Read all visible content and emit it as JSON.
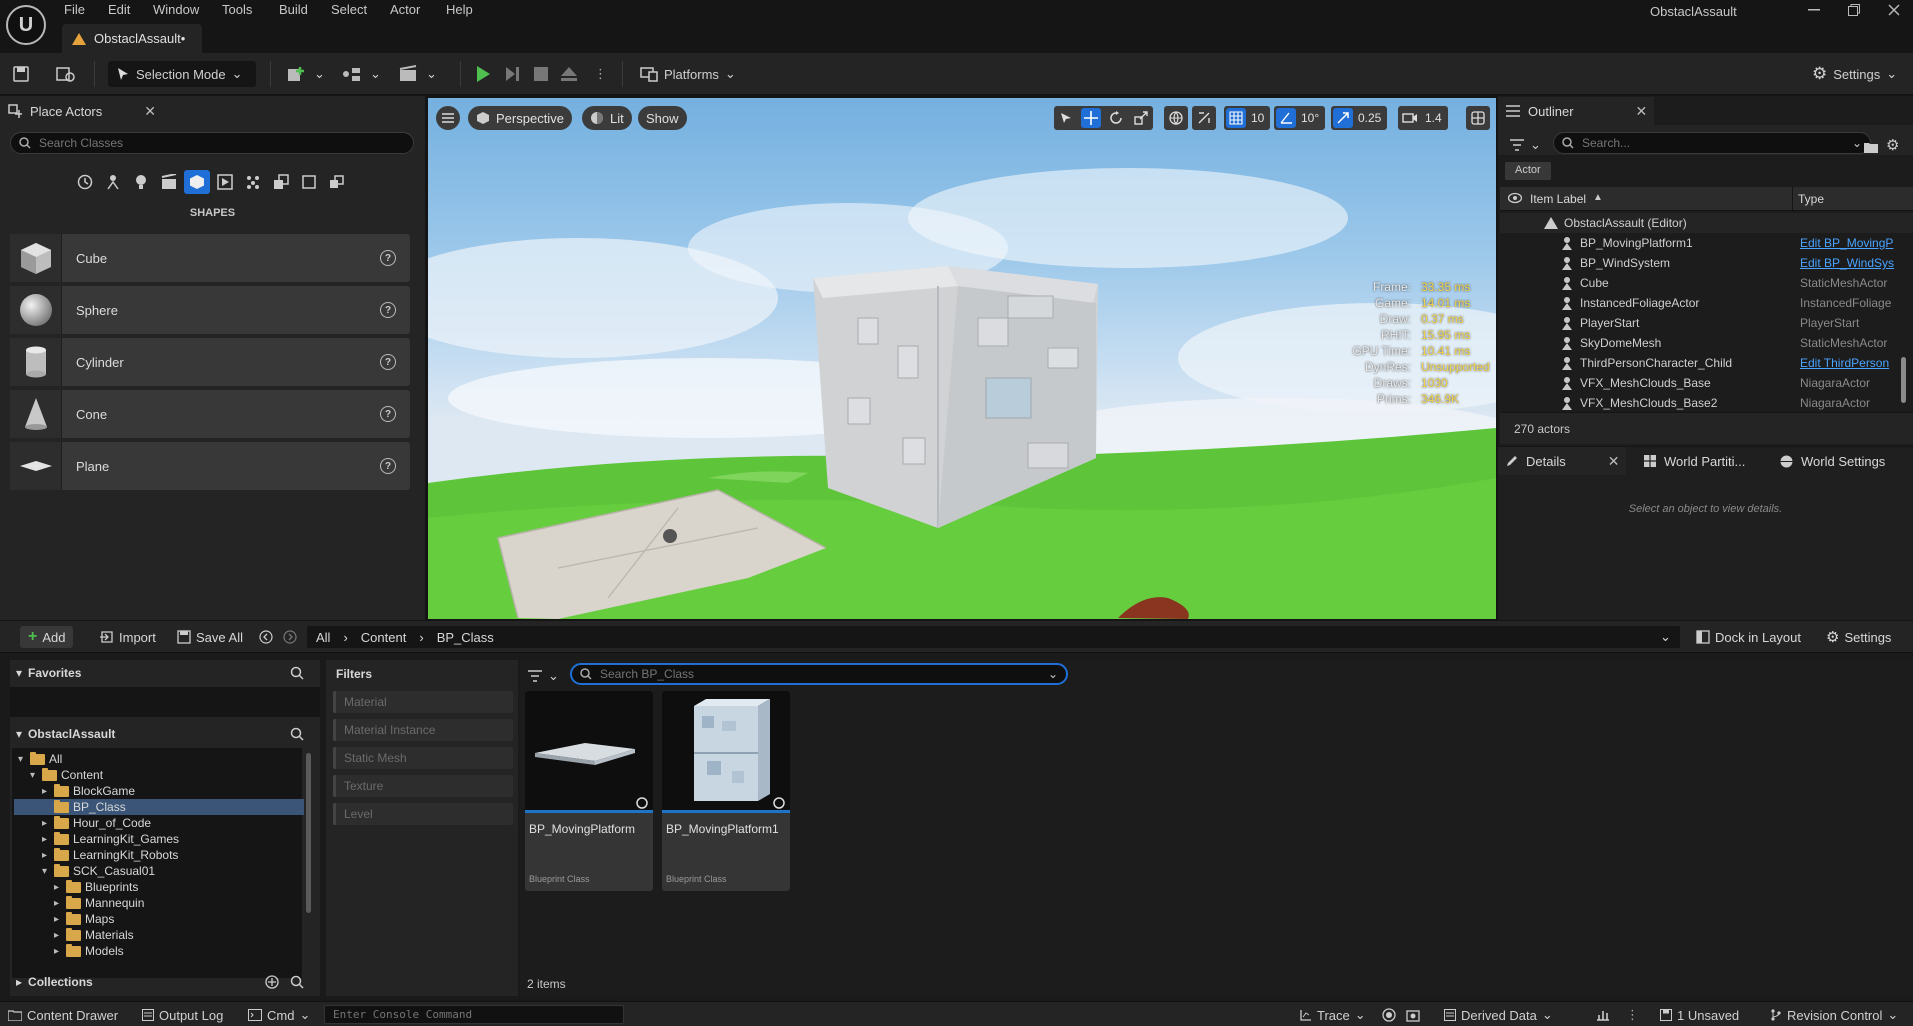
{
  "window": {
    "title": "ObstaclAssault",
    "tab": "ObstaclAssault•"
  },
  "menu": [
    "File",
    "Edit",
    "Window",
    "Tools",
    "Build",
    "Select",
    "Actor",
    "Help"
  ],
  "toolbar": {
    "selection_mode": "Selection Mode",
    "platforms": "Platforms",
    "settings": "Settings"
  },
  "place_actors": {
    "tab": "Place Actors",
    "search_placeholder": "Search Classes",
    "category": "SHAPES",
    "items": [
      "Cube",
      "Sphere",
      "Cylinder",
      "Cone",
      "Plane"
    ]
  },
  "viewport": {
    "perspective": "Perspective",
    "lit": "Lit",
    "show": "Show",
    "grid_snap": "10",
    "rot_snap": "10°",
    "scale_snap": "0.25",
    "cam_speed": "1.4",
    "stats": [
      {
        "k": "Frame:",
        "v": "33.35 ms"
      },
      {
        "k": "Game:",
        "v": "14.01 ms"
      },
      {
        "k": "Draw:",
        "v": "0.37 ms"
      },
      {
        "k": "RHIT:",
        "v": "15.95 ms"
      },
      {
        "k": "GPU Time:",
        "v": "10.41 ms"
      },
      {
        "k": "DynRes:",
        "v": "Unsupported"
      },
      {
        "k": "Draws:",
        "v": "1030"
      },
      {
        "k": "Prims:",
        "v": "346.9K"
      }
    ]
  },
  "outliner": {
    "tab": "Outliner",
    "search_placeholder": "Search...",
    "filter_chip": "Actor",
    "col_label": "Item Label",
    "col_type": "Type",
    "root": "ObstaclAssault (Editor)",
    "rows": [
      {
        "label": "BP_MovingPlatform1",
        "type": "Edit BP_MovingP",
        "link": true
      },
      {
        "label": "BP_WindSystem",
        "type": "Edit BP_WindSys",
        "link": true
      },
      {
        "label": "Cube",
        "type": "StaticMeshActor",
        "link": false
      },
      {
        "label": "InstancedFoliageActor",
        "type": "InstancedFoliage",
        "link": false
      },
      {
        "label": "PlayerStart",
        "type": "PlayerStart",
        "link": false
      },
      {
        "label": "SkyDomeMesh",
        "type": "StaticMeshActor",
        "link": false
      },
      {
        "label": "ThirdPersonCharacter_Child",
        "type": "Edit ThirdPerson",
        "link": true
      },
      {
        "label": "VFX_MeshClouds_Base",
        "type": "NiagaraActor",
        "link": false
      },
      {
        "label": "VFX_MeshClouds_Base2",
        "type": "NiagaraActor",
        "link": false
      }
    ],
    "count": "270 actors"
  },
  "details": {
    "tab": "Details",
    "tab2": "World Partiti...",
    "tab3": "World Settings",
    "empty": "Select an object to view details."
  },
  "content_browser": {
    "add": "Add",
    "import": "Import",
    "save_all": "Save All",
    "path": [
      "All",
      "Content",
      "BP_Class"
    ],
    "dock": "Dock in Layout",
    "settings": "Settings",
    "favorites": "Favorites",
    "project": "ObstaclAssault",
    "tree": [
      {
        "label": "All",
        "depth": 0
      },
      {
        "label": "Content",
        "depth": 1
      },
      {
        "label": "BlockGame",
        "depth": 2
      },
      {
        "label": "BP_Class",
        "depth": 2
      },
      {
        "label": "Hour_of_Code",
        "depth": 2
      },
      {
        "label": "LearningKit_Games",
        "depth": 2
      },
      {
        "label": "LearningKit_Robots",
        "depth": 2
      },
      {
        "label": "SCK_Casual01",
        "depth": 2
      },
      {
        "label": "Blueprints",
        "depth": 3
      },
      {
        "label": "Mannequin",
        "depth": 3
      },
      {
        "label": "Maps",
        "depth": 3
      },
      {
        "label": "Materials",
        "depth": 3
      },
      {
        "label": "Models",
        "depth": 3
      }
    ],
    "collections": "Collections",
    "filters_title": "Filters",
    "filters": [
      "Material",
      "Material Instance",
      "Static Mesh",
      "Texture",
      "Level"
    ],
    "search_placeholder": "Search BP_Class",
    "assets": [
      {
        "name": "BP_MovingPlatform",
        "type": "Blueprint Class"
      },
      {
        "name": "BP_MovingPlatform1",
        "type": "Blueprint Class"
      }
    ],
    "item_count": "2 items"
  },
  "statusbar": {
    "content_drawer": "Content Drawer",
    "output_log": "Output Log",
    "cmd": "Cmd",
    "console_placeholder": "Enter Console Command",
    "trace": "Trace",
    "derived": "Derived Data",
    "unsaved": "1 Unsaved",
    "revision": "Revision Control"
  }
}
